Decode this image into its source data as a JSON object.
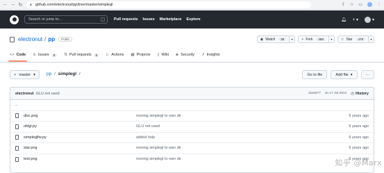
{
  "browser": {
    "back_icon": "arrow-left-icon",
    "url": "github.com/electronut/pp/tree/master/simplegl"
  },
  "header": {
    "search_placeholder": "Search or jump to...",
    "search_shortcut": "/",
    "nav": [
      "Pull requests",
      "Issues",
      "Marketplace",
      "Explore"
    ],
    "plus_label": "+"
  },
  "repo": {
    "owner": "electronut",
    "separator": "/",
    "name": "pp",
    "visibility": "Public",
    "watch": {
      "label": "Watch",
      "count": "35"
    },
    "fork": {
      "label": "Fork",
      "count": "468"
    },
    "star": {
      "label": "Star",
      "count": "479"
    }
  },
  "tabs": [
    {
      "label": "Code",
      "icon": "code-icon"
    },
    {
      "label": "Issues",
      "count": "9",
      "icon": "issue-icon"
    },
    {
      "label": "Pull requests",
      "count": "5",
      "icon": "pull-request-icon"
    },
    {
      "label": "Actions",
      "icon": "play-icon"
    },
    {
      "label": "Projects",
      "icon": "table-icon"
    },
    {
      "label": "Wiki",
      "icon": "book-icon"
    },
    {
      "label": "Security",
      "icon": "shield-icon"
    },
    {
      "label": "Insights",
      "icon": "graph-icon"
    }
  ],
  "branch": {
    "name": "master",
    "crumb_repo": "pp",
    "crumb_path": "simplegl",
    "crumb_sep": "/"
  },
  "buttons": {
    "go_to_file": "Go to file",
    "add_file": "Add file",
    "more": "···"
  },
  "latest_commit": {
    "author": "electronut",
    "message": "GLU not used",
    "hash": "1115077",
    "date": "on 17 Jul 2014",
    "history_label": "History"
  },
  "files": [
    {
      "name": "disc.png",
      "message": "moving simplegl to own dir",
      "age": "9 years ago"
    },
    {
      "name": "oldgl.py",
      "message": "GLU not used",
      "age": "9 years ago"
    },
    {
      "name": "simpleglfw.py",
      "message": "added help",
      "age": "9 years ago"
    },
    {
      "name": "star.png",
      "message": "moving simplegl to own dir",
      "age": "9 years ago"
    },
    {
      "name": "test.png",
      "message": "moving simplegl to own dir",
      "age": "9 years ago"
    }
  ],
  "up_dir": "..",
  "watermark": "知乎 @Marx"
}
